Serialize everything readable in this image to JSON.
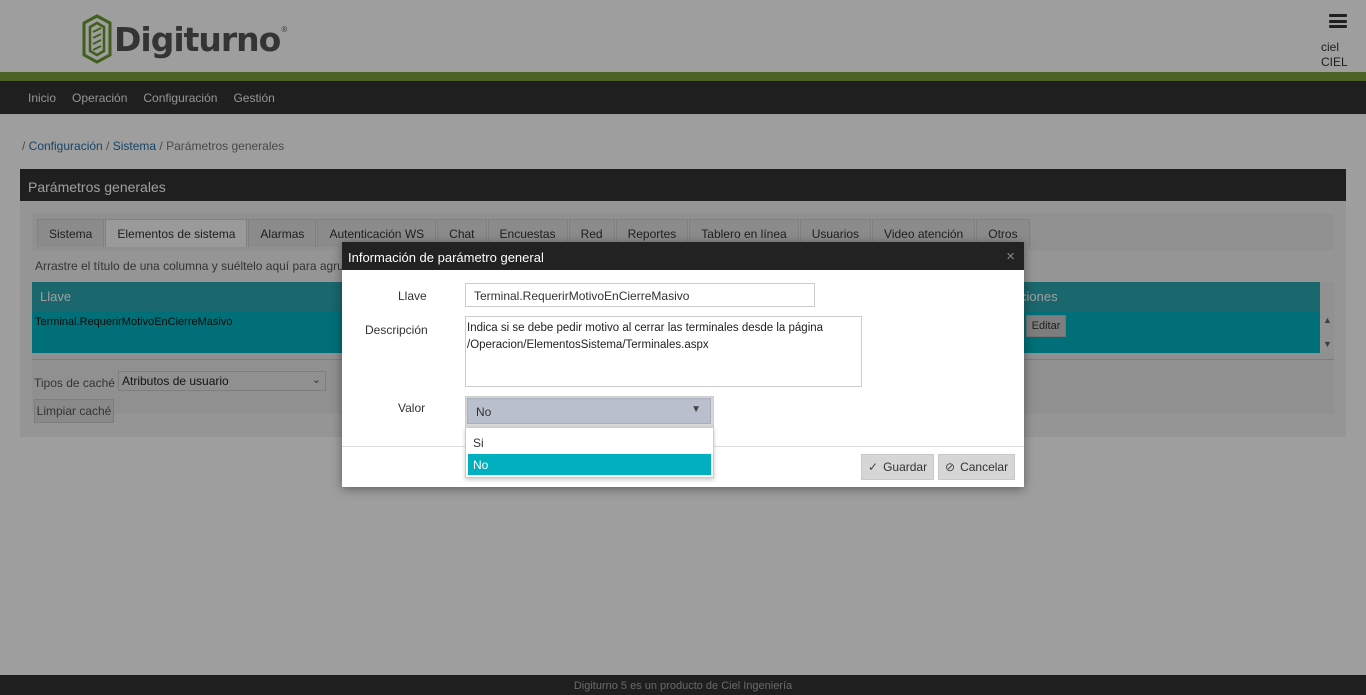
{
  "header": {
    "logo_text": "Digiturno",
    "logo_reg": "®",
    "user_name": "ciel",
    "user_org": "CIEL"
  },
  "nav": [
    "Inicio",
    "Operación",
    "Configuración",
    "Gestión"
  ],
  "breadcrumb": {
    "sep1": "/ ",
    "item1": "Configuración",
    "sep2": " / ",
    "item2": "Sistema",
    "sep3": " / ",
    "current": "Parámetros generales"
  },
  "panel": {
    "title": "Parámetros generales",
    "tabs": [
      "Sistema",
      "Elementos de sistema",
      "Alarmas",
      "Autenticación WS",
      "Chat",
      "Encuestas",
      "Red",
      "Reportes",
      "Tablero en línea",
      "Usuarios",
      "Video atención",
      "Otros"
    ],
    "active_tab": "Elementos de sistema",
    "group_hint": "Arrastre el título de una columna y suéltelo aquí para agrupar",
    "grid_col1": "Llave",
    "grid_col2": "ciones",
    "row_key": "Terminal.RequerirMotivoEnCierreMasivo",
    "edit_label": "Editar",
    "cache_label": "Tipos de caché",
    "cache_value": "Atributos de usuario",
    "clear_label": "Limpiar caché"
  },
  "dialog": {
    "title": "Información de parámetro general",
    "close": "×",
    "llave_label": "Llave",
    "llave_value": "Terminal.RequerirMotivoEnCierreMasivo",
    "desc_label": "Descripción",
    "desc_value": "Indica si se debe pedir motivo al cerrar las terminales desde la página /Operacion/ElementosSistema/Terminales.aspx",
    "valor_label": "Valor",
    "valor_value": "No",
    "options": [
      "Si",
      "No"
    ],
    "selected_option": "No",
    "save_label": "Guardar",
    "cancel_label": "Cancelar"
  },
  "footer": {
    "text": "Digiturno 5 es un producto de Ciel Ingeniería"
  },
  "colors": {
    "brand_green": "#7aa03a",
    "accent_teal": "#00b3c0",
    "dark": "#333333"
  }
}
